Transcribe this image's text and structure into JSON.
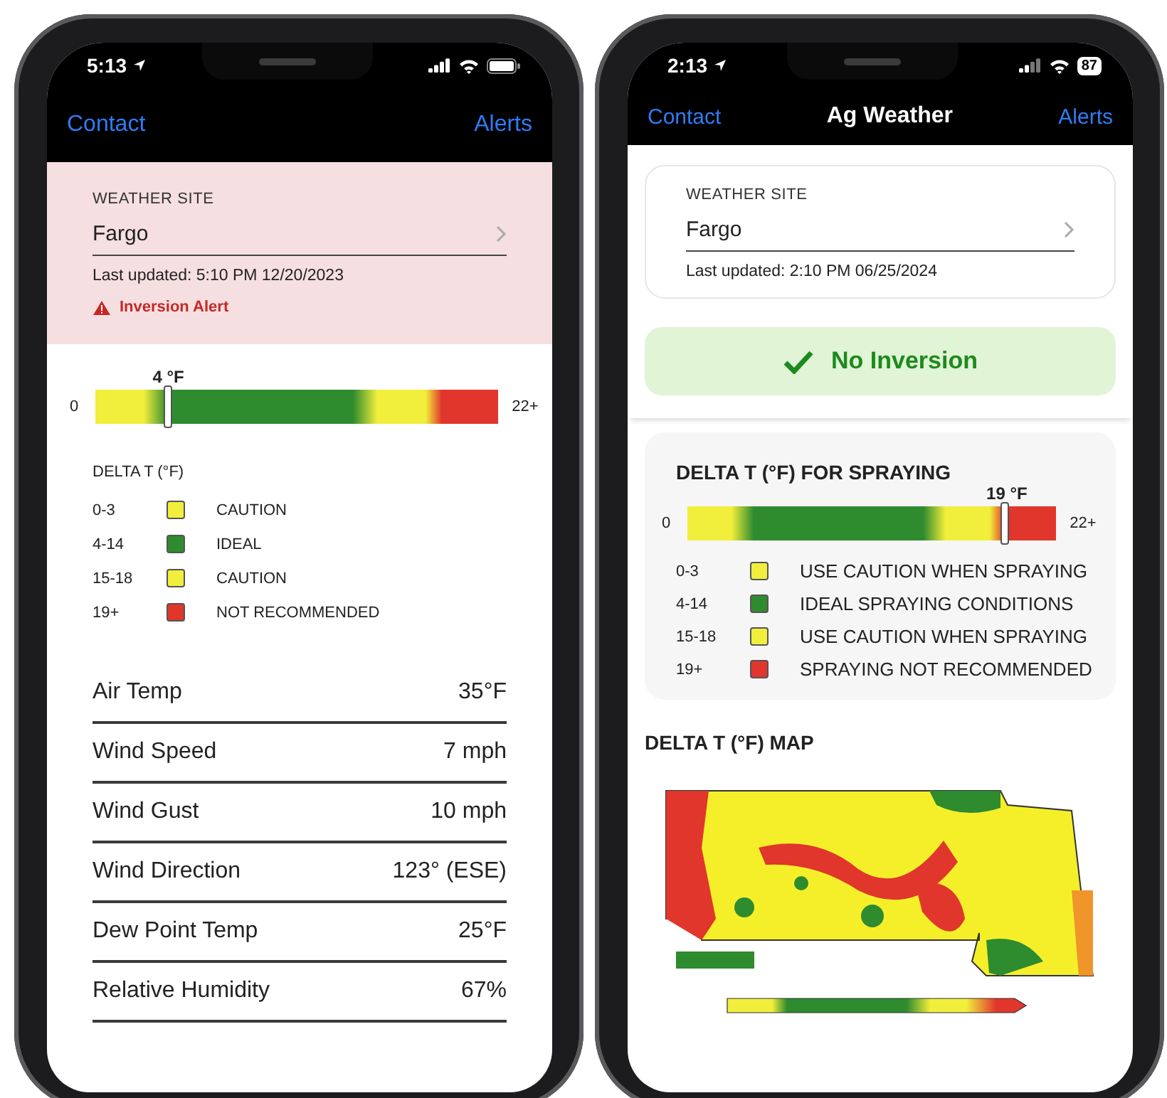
{
  "left_phone": {
    "status_bar": {
      "time": "5:13"
    },
    "nav": {
      "contact": "Contact",
      "alerts": "Alerts"
    },
    "weather_site": {
      "label": "WEATHER SITE",
      "value": "Fargo",
      "last_updated": "Last updated: 5:10 PM 12/20/2023"
    },
    "alert": {
      "kind": "warning",
      "text": "Inversion Alert"
    },
    "delta_t": {
      "reading": "4 °F",
      "level": 0.18,
      "min_label": "0",
      "max_label": "22+",
      "legend_title": "DELTA T (°F)",
      "legend": [
        {
          "range": "0-3",
          "label": "CAUTION",
          "color": "#f2ee3c"
        },
        {
          "range": "4-14",
          "label": "IDEAL",
          "color": "#2e8b2e"
        },
        {
          "range": "15-18",
          "label": "CAUTION",
          "color": "#f2ee3c"
        },
        {
          "range": "19+",
          "label": "NOT RECOMMENDED",
          "color": "#e0362c"
        }
      ]
    },
    "readings": [
      {
        "label": "Air Temp",
        "value": "35°F"
      },
      {
        "label": "Wind Speed",
        "value": "7 mph"
      },
      {
        "label": "Wind Gust",
        "value": "10 mph"
      },
      {
        "label": "Wind Direction",
        "value": "123° (ESE)"
      },
      {
        "label": "Dew Point Temp",
        "value": "25°F"
      },
      {
        "label": "Relative Humidity",
        "value": "67%"
      }
    ]
  },
  "right_phone": {
    "status_bar": {
      "time": "2:13",
      "battery": "87"
    },
    "nav": {
      "contact": "Contact",
      "title": "Ag Weather",
      "alerts": "Alerts"
    },
    "weather_site": {
      "label": "WEATHER SITE",
      "value": "Fargo",
      "last_updated": "Last updated: 2:10 PM 06/25/2024"
    },
    "alert": {
      "kind": "ok",
      "text": "No Inversion"
    },
    "delta_t": {
      "title": "DELTA T (°F) FOR SPRAYING",
      "reading": "19 °F",
      "level": 0.86,
      "min_label": "0",
      "max_label": "22+",
      "legend": [
        {
          "range": "0-3",
          "label": "USE CAUTION WHEN SPRAYING",
          "color": "#f2ee3c"
        },
        {
          "range": "4-14",
          "label": "IDEAL SPRAYING CONDITIONS",
          "color": "#2e8b2e"
        },
        {
          "range": "15-18",
          "label": "USE CAUTION WHEN SPRAYING",
          "color": "#f2ee3c"
        },
        {
          "range": "19+",
          "label": "SPRAYING NOT RECOMMENDED",
          "color": "#e0362c"
        }
      ]
    },
    "map": {
      "title": "DELTA T (°F) MAP"
    }
  }
}
